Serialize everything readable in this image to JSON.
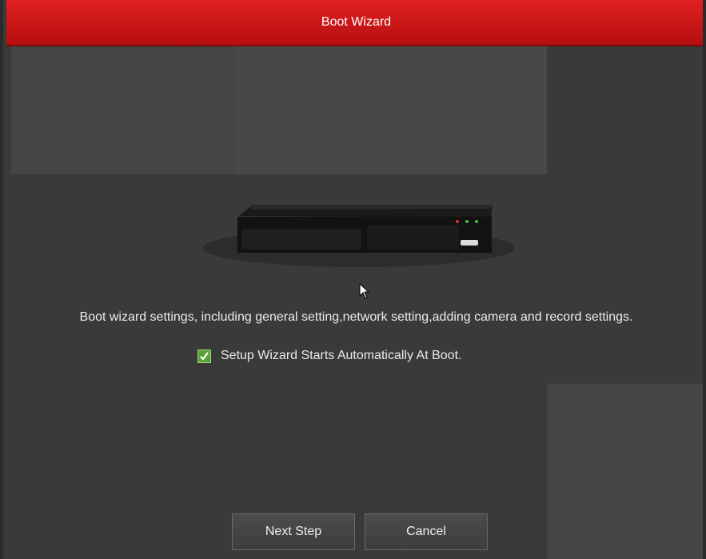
{
  "window": {
    "title": "Boot Wizard"
  },
  "content": {
    "description": "Boot wizard settings, including general setting,network setting,adding camera and record settings.",
    "auto_start_checkbox": {
      "label": "Setup Wizard Starts Automatically At Boot.",
      "checked": true
    }
  },
  "buttons": {
    "next": "Next Step",
    "cancel": "Cancel"
  },
  "colors": {
    "titlebar": "#d41818",
    "background": "#3a3a3a",
    "checkbox": "#5aa33b"
  }
}
